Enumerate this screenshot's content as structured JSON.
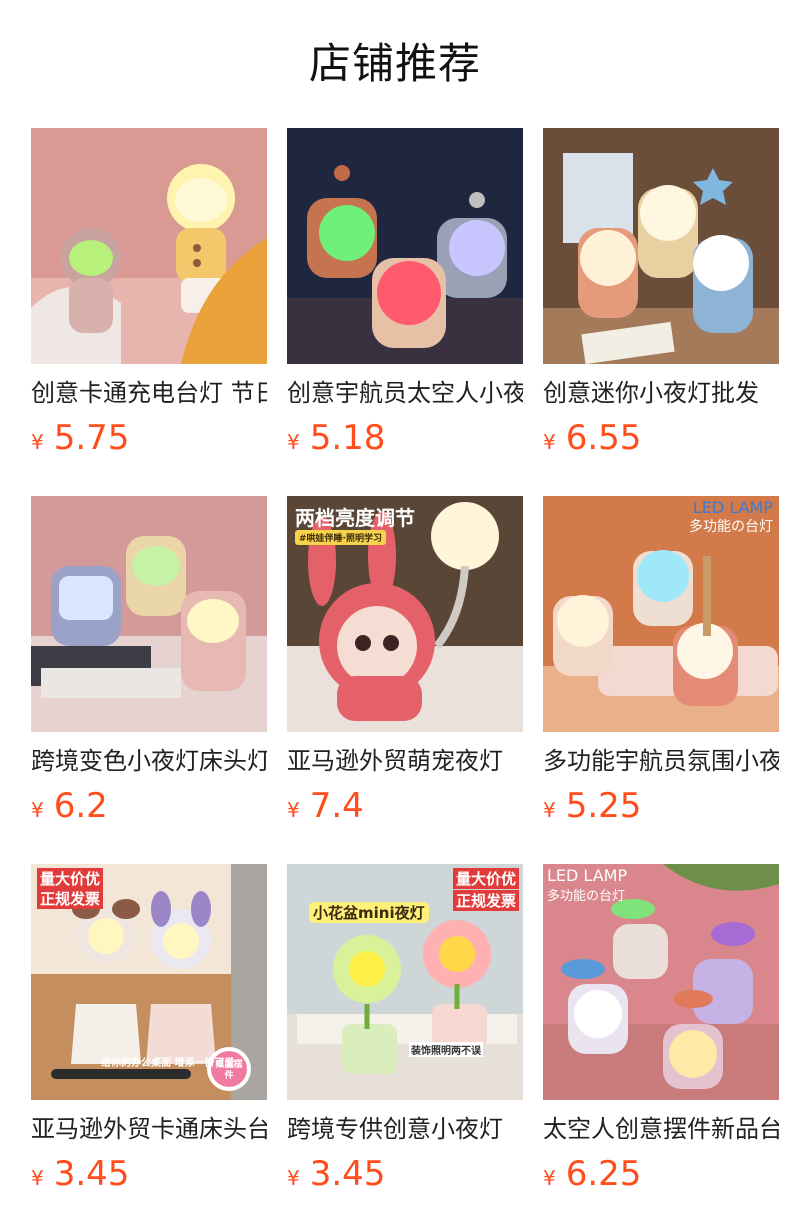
{
  "header": {
    "title": "店铺推荐"
  },
  "colors": {
    "price": "#ff4d1c",
    "title": "#111111",
    "text": "#222222"
  },
  "products": [
    {
      "name": "创意卡通充电台灯 节日礼物",
      "currency": "¥",
      "price": "5.75",
      "image_theme": "cartoon-deer-lamps"
    },
    {
      "name": "创意宇航员太空人小夜灯",
      "currency": "¥",
      "price": "5.18",
      "image_theme": "astronaut-night-lights"
    },
    {
      "name": "创意迷你小夜灯批发",
      "currency": "¥",
      "price": "6.55",
      "image_theme": "astronaut-clip-lamps"
    },
    {
      "name": "跨境变色小夜灯床头灯",
      "currency": "¥",
      "price": "6.2",
      "image_theme": "color-changing-robot-lamps"
    },
    {
      "name": "亚马逊外贸萌宠夜灯",
      "currency": "¥",
      "price": "7.4",
      "image_theme": "bunny-pet-lamp",
      "overlay": {
        "headline": "两档亮度调节",
        "tag": "#哄娃伴睡·照明学习"
      }
    },
    {
      "name": "多功能宇航员氛围小夜灯",
      "currency": "¥",
      "price": "5.25",
      "image_theme": "astronaut-pen-holder",
      "overlay": {
        "headline": "LED LAMP",
        "sub": "多功能の台灯"
      }
    },
    {
      "name": "亚马逊外贸卡通床头台灯",
      "currency": "¥",
      "price": "3.45",
      "image_theme": "cartoon-spring-lamps",
      "overlay": {
        "badge1": "量大价优",
        "badge2": "正规发票",
        "caption": "给你的办公桌面 增添一份可爱",
        "sticker": "桌面摆件"
      }
    },
    {
      "name": "跨境专供创意小夜灯",
      "currency": "¥",
      "price": "3.45",
      "image_theme": "flower-pot-lamps",
      "overlay": {
        "badge1": "量大价优",
        "badge2": "正规发票",
        "headline": "小花盆mini夜灯",
        "caption": "装饰照明两不误"
      }
    },
    {
      "name": "太空人创意摆件新品台灯",
      "currency": "¥",
      "price": "6.25",
      "image_theme": "astronaut-desk-lamps",
      "overlay": {
        "headline": "LED LAMP",
        "sub": "多功能の台灯"
      }
    }
  ]
}
